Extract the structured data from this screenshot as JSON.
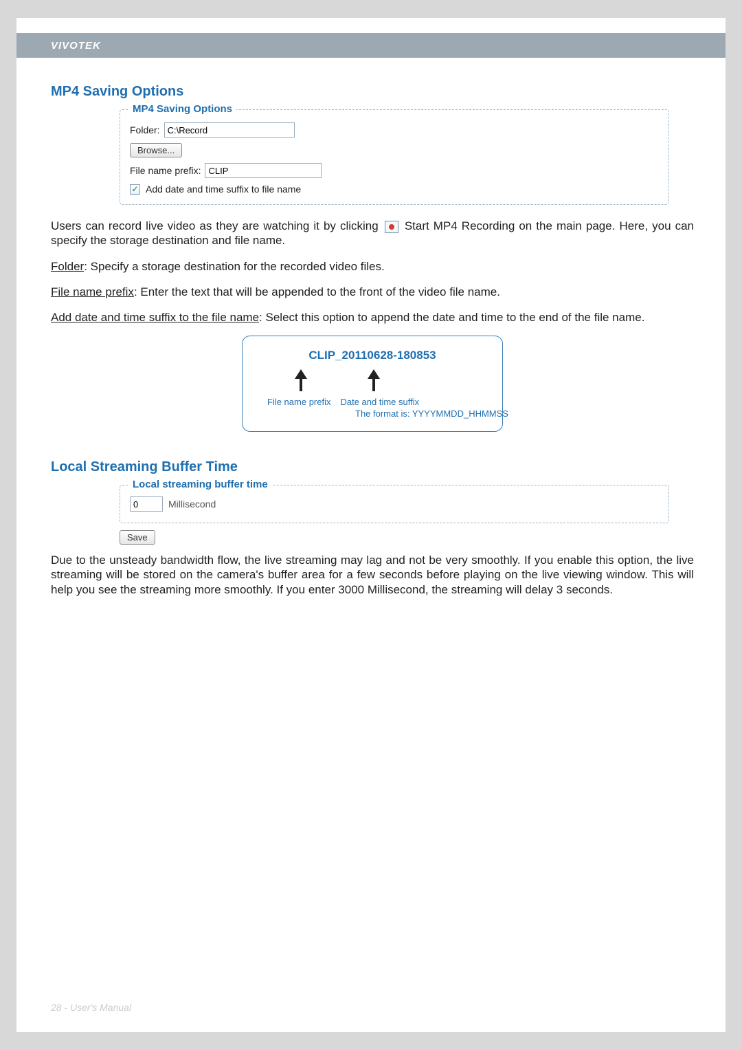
{
  "header": {
    "brand": "VIVOTEK"
  },
  "sections": {
    "mp4": {
      "title": "MP4 Saving Options",
      "legend": "MP4 Saving Options",
      "folder_label": "Folder:",
      "folder_value": "C:\\Record",
      "browse_label": "Browse...",
      "prefix_label": "File name prefix:",
      "prefix_value": "CLIP",
      "suffix_checkbox_label": "Add date and time suffix to file name",
      "suffix_checked": true
    },
    "mp4_desc": {
      "p1a": "Users can record live video as they are watching it by clicking ",
      "p1b": " Start MP4 Recording on the main page. Here, you can specify the storage destination and file name.",
      "p2_label": "Folder",
      "p2_rest": ": Specify a storage destination for the recorded video files.",
      "p3_label": "File name prefix",
      "p3_rest": ": Enter the text that will be appended to the front of the video file name.",
      "p4_label": "Add date and time suffix to the file name",
      "p4_rest": ": Select this option to append the date and time to the end of the file name."
    },
    "example": {
      "filename": "CLIP_20110628-180853",
      "cap_prefix": "File name prefix",
      "cap_suffix": "Date and time suffix",
      "cap_format": "The format is: YYYYMMDD_HHMMSS"
    },
    "buffer": {
      "title": "Local Streaming Buffer Time",
      "legend": "Local streaming buffer time",
      "value": "0",
      "unit": "Millisecond",
      "save_label": "Save",
      "desc": "Due to the unsteady bandwidth flow, the live streaming may lag and not be very smoothly. If you enable this option, the live streaming will be stored on the camera's buffer area for a few seconds before playing on the live viewing window. This will help you see the streaming more smoothly. If you enter 3000 Millisecond, the streaming will delay 3 seconds."
    }
  },
  "footer": {
    "text": "28 - User's Manual"
  }
}
